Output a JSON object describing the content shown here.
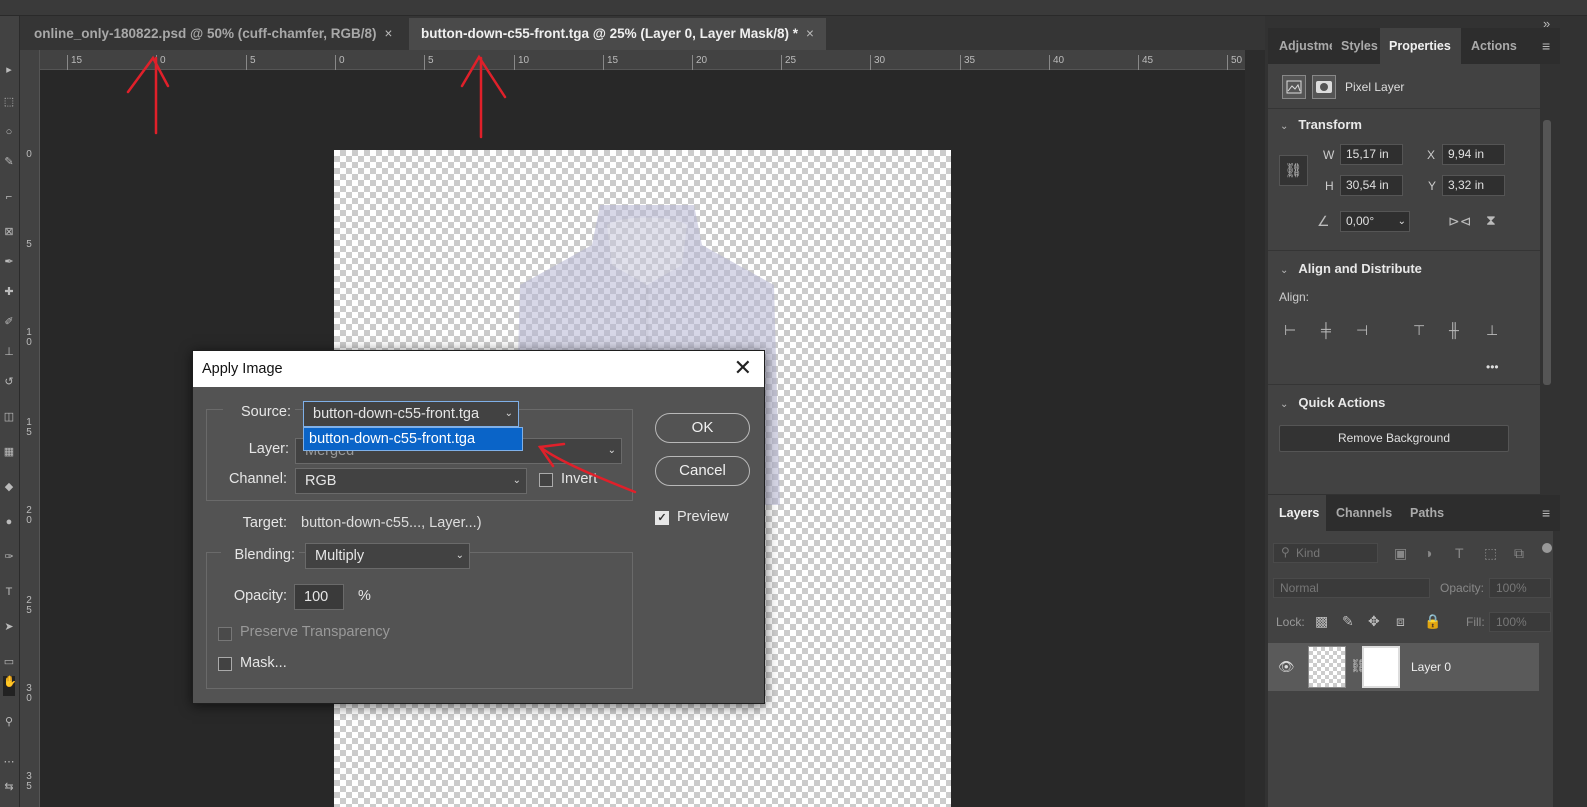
{
  "document_tabs": [
    {
      "label": "online_only-180822.psd @ 50% (cuff-chamfer, RGB/8)",
      "close": "×",
      "active": false
    },
    {
      "label": "button-down-c55-front.tga @ 25% (Layer 0, Layer Mask/8) *",
      "close": "×",
      "active": true
    }
  ],
  "ruler": {
    "h_ticks": [
      "15",
      "0",
      "5",
      "0",
      "5",
      "10",
      "15",
      "20",
      "25",
      "30",
      "35",
      "40",
      "45",
      "50"
    ],
    "v_ticks": [
      "0",
      "5",
      "1 0",
      "1 5",
      "2 0",
      "2 5",
      "3 0",
      "3 5"
    ]
  },
  "properties_panel": {
    "tabs": [
      "Adjustme",
      "Styles",
      "Properties",
      "Actions"
    ],
    "active_tab": "Properties",
    "collapse_icon": "»",
    "menu_icon": "≡",
    "layer_type": "Pixel Layer",
    "transform": {
      "heading": "Transform",
      "w_label": "W",
      "w_value": "15,17 in",
      "h_label": "H",
      "h_value": "30,54 in",
      "x_label": "X",
      "x_value": "9,94 in",
      "y_label": "Y",
      "y_value": "3,32 in",
      "angle_value": "0,00°"
    },
    "align": {
      "heading": "Align and Distribute",
      "align_label": "Align:",
      "more": "•••"
    },
    "quick_actions": {
      "heading": "Quick Actions",
      "remove_bg": "Remove Background"
    }
  },
  "layers_panel": {
    "tabs": [
      "Layers",
      "Channels",
      "Paths"
    ],
    "active_tab": "Layers",
    "kind_placeholder": "Kind",
    "blend_mode": "Normal",
    "opacity_label": "Opacity:",
    "opacity_value": "100%",
    "lock_label": "Lock:",
    "fill_label": "Fill:",
    "fill_value": "100%",
    "layers": [
      {
        "name": "Layer 0",
        "visible": true
      }
    ]
  },
  "apply_image_dialog": {
    "title": "Apply Image",
    "close": "✕",
    "source_label": "Source:",
    "source_value": "button-down-c55-front.tga",
    "source_dropdown_item": "button-down-c55-front.tga",
    "layer_label": "Layer:",
    "layer_value": "Merged",
    "channel_label": "Channel:",
    "channel_value": "RGB",
    "invert_label": "Invert",
    "invert_checked": false,
    "target_label": "Target:",
    "target_value": "button-down-c55..., Layer...)",
    "blending_label": "Blending:",
    "blending_value": "Multiply",
    "opacity_label": "Opacity:",
    "opacity_value": "100",
    "opacity_unit": "%",
    "preserve_transparency_label": "Preserve Transparency",
    "mask_label": "Mask...",
    "ok_label": "OK",
    "cancel_label": "Cancel",
    "preview_label": "Preview",
    "preview_checked": true
  },
  "colors": {
    "annotation_red": "#e0202a",
    "selection_blue": "#0a64c8"
  }
}
